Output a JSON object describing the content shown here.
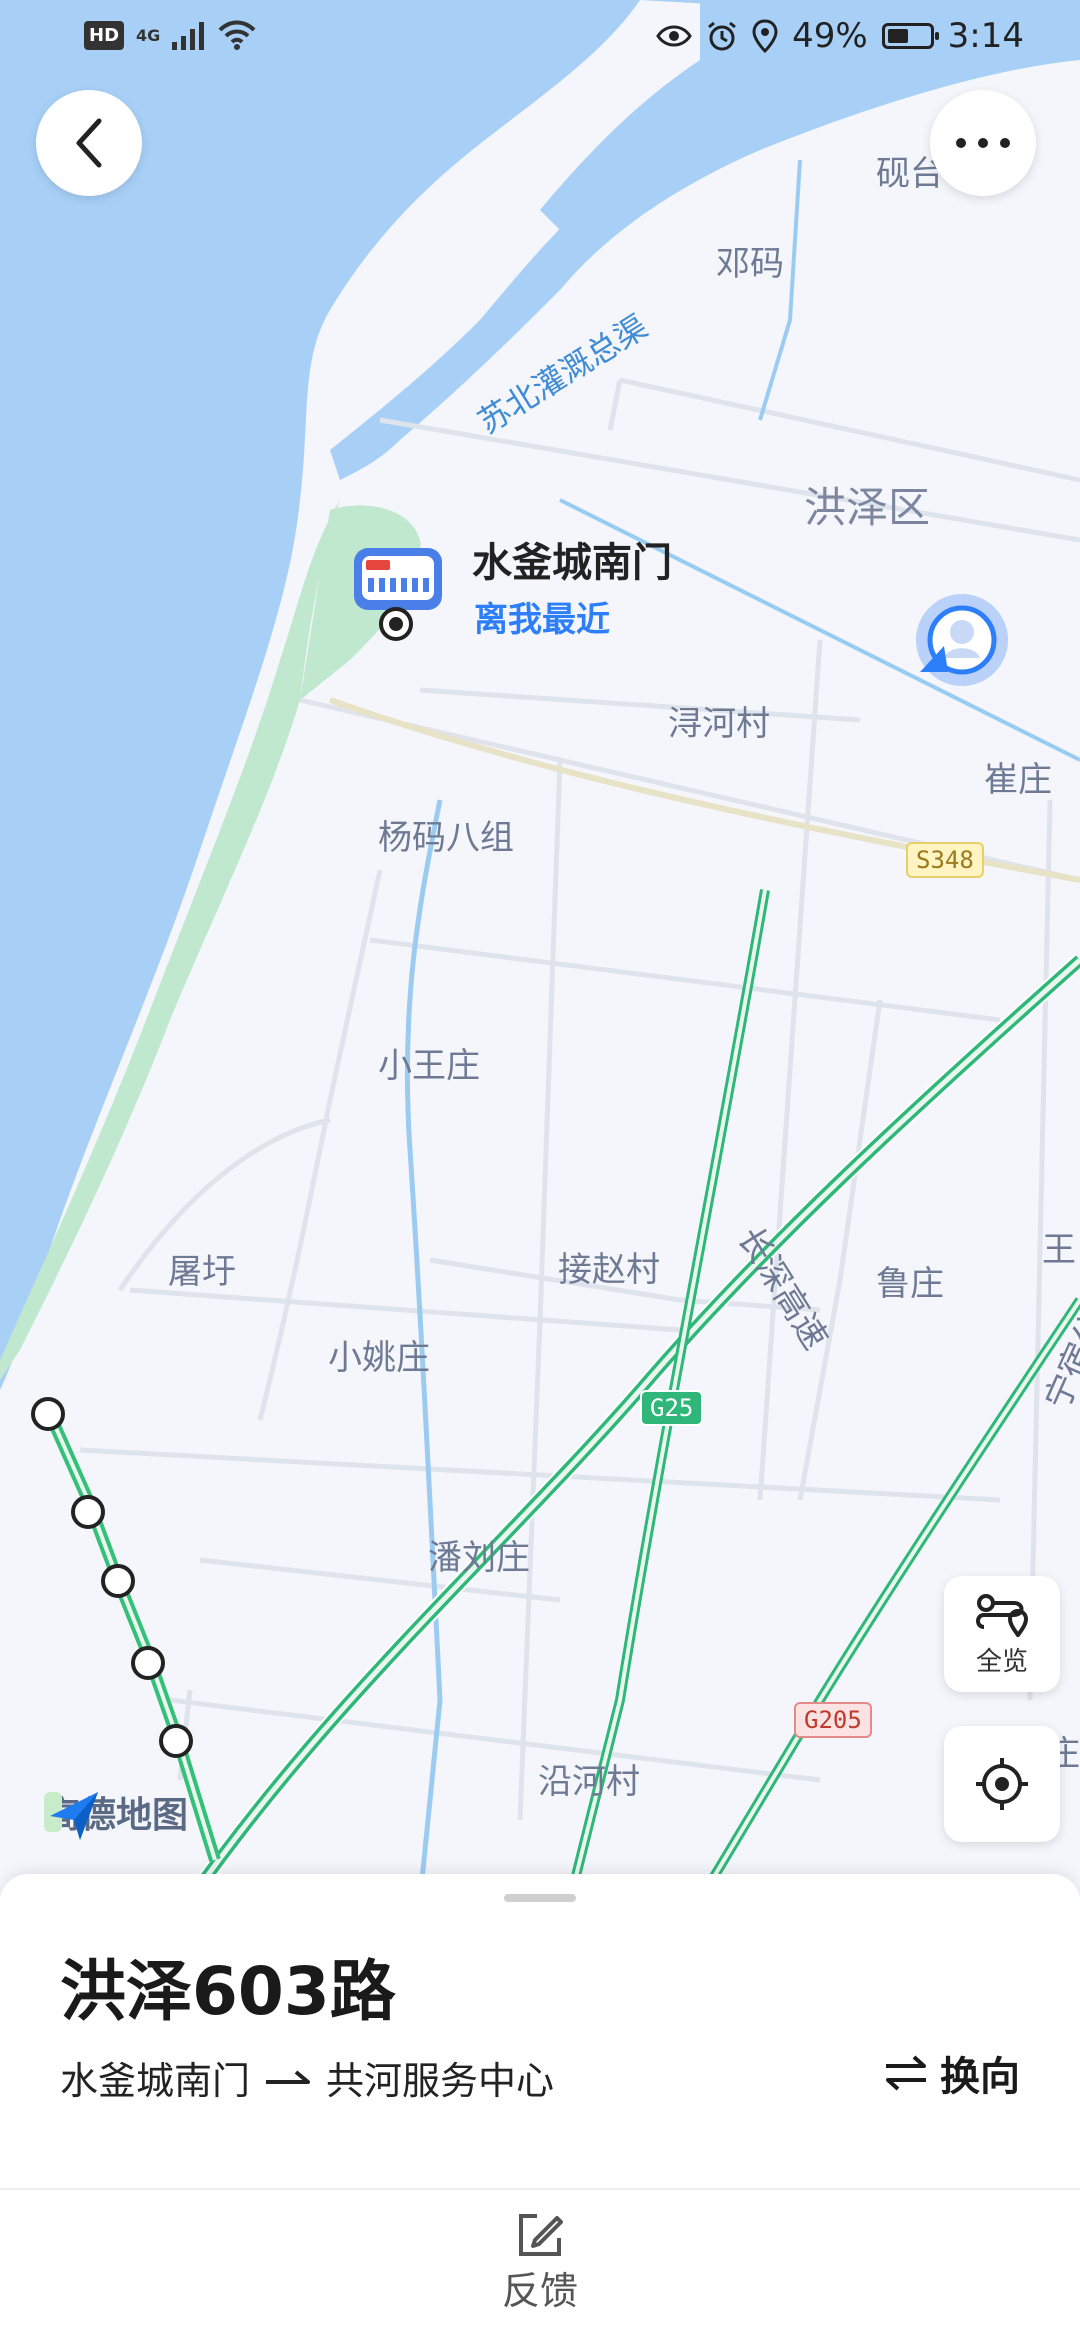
{
  "status_bar": {
    "hd": "HD",
    "net": "4G",
    "battery_percent": "49%",
    "battery_level": 0.49,
    "time": "3:14"
  },
  "icons": {
    "back": "back-arrow-icon",
    "more": "more-dots-icon",
    "overview": "route-overview-icon",
    "locate": "locate-icon"
  },
  "map": {
    "labels": [
      {
        "id": "yantai",
        "text": "砚台"
      },
      {
        "id": "dengma",
        "text": "邓码"
      },
      {
        "id": "canal",
        "text": "苏北灌溉总渠"
      },
      {
        "id": "hongze",
        "text": "洪泽区"
      },
      {
        "id": "xunhe",
        "text": "浔河村"
      },
      {
        "id": "cuizhuang",
        "text": "崔庄"
      },
      {
        "id": "yangma",
        "text": "杨码八组"
      },
      {
        "id": "xiaowang",
        "text": "小王庄"
      },
      {
        "id": "tuwei",
        "text": "屠圩"
      },
      {
        "id": "jiezhao",
        "text": "接赵村"
      },
      {
        "id": "luzhuang",
        "text": "鲁庄"
      },
      {
        "id": "wang",
        "text": "王"
      },
      {
        "id": "xiaoyao",
        "text": "小姚庄"
      },
      {
        "id": "panliu",
        "text": "潘刘庄"
      },
      {
        "id": "yanhe",
        "text": "沿河村"
      },
      {
        "id": "zhuang",
        "text": "庄"
      },
      {
        "id": "highway",
        "text": "长深高速"
      },
      {
        "id": "ningsu",
        "text": "宁宿公路"
      }
    ],
    "shields": {
      "s348": "S348",
      "g25": "G25",
      "g205": "G205"
    }
  },
  "stop": {
    "name": "水釜城南门",
    "tag": "离我最近"
  },
  "overview_label": "全览",
  "logo_text": "高德地图",
  "sheet": {
    "route_name": "洪泽603路",
    "from": "水釜城南门",
    "to": "共河服务中心",
    "switch_label": "换向",
    "feedback_label": "反馈"
  },
  "colors": {
    "water": "#a8d0f7",
    "land": "#f4f6fb",
    "green_strip": "#bfe8cf",
    "highway": "#2fb77a",
    "route": "#35c07a",
    "accent": "#2d7ff9"
  }
}
